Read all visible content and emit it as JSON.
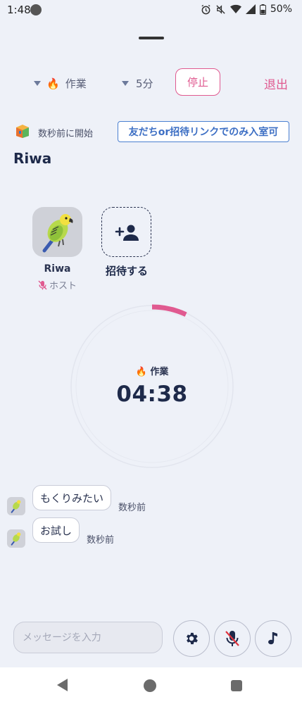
{
  "status_bar": {
    "time": "1:48",
    "battery": "50%",
    "icons": [
      "alarm-icon",
      "mute-icon",
      "wifi-icon",
      "signal-icon",
      "battery-icon"
    ]
  },
  "controls": {
    "mode_emoji": "🔥",
    "mode_label": "作業",
    "duration_label": "5分",
    "stop_label": "停止",
    "exit_label": "退出"
  },
  "room": {
    "started_text": "数秒前に開始",
    "access_badge": "友だちor招待リンクでのみ入室可",
    "name": "Riwa"
  },
  "members": [
    {
      "name": "Riwa",
      "role": "ホスト",
      "mic_muted": true
    }
  ],
  "invite_label": "招待する",
  "timer": {
    "mode_emoji": "🔥",
    "mode_label": "作業",
    "time": "04:38",
    "progress": 0.07,
    "accent_color": "#e05a90"
  },
  "chat": [
    {
      "text": "もくりみたい",
      "time": "数秒前"
    },
    {
      "text": "お試し",
      "time": "数秒前"
    }
  ],
  "composer": {
    "placeholder": "メッセージを入力"
  },
  "colors": {
    "background": "#eef1f8",
    "accent": "#e05a90",
    "link_blue": "#3d6fc4",
    "text_dark": "#1e2a4a"
  }
}
